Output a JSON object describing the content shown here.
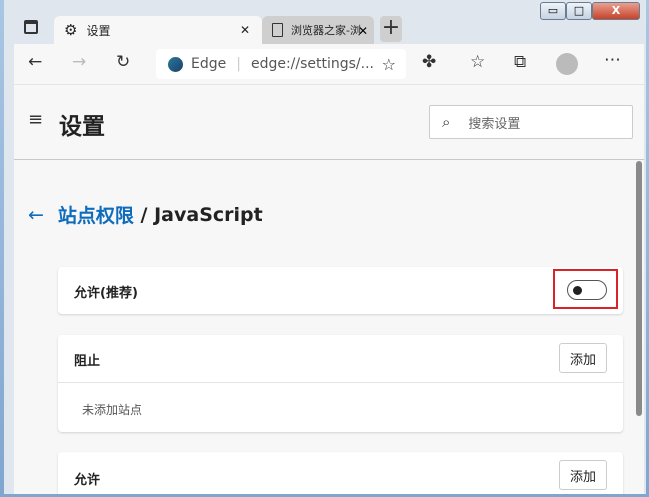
{
  "tabs": [
    {
      "label": "设置",
      "icon": "gear-icon"
    },
    {
      "label": "浏览器之家-浏览器下载_浏",
      "icon": "page-icon"
    }
  ],
  "window_controls": {
    "minimize": "▭",
    "maximize": "□",
    "close": "X"
  },
  "address": {
    "site": "Edge",
    "url": "edge://settings/..."
  },
  "header": {
    "title": "设置",
    "search_placeholder": "搜索设置"
  },
  "breadcrumb": {
    "parent": "站点权限",
    "sep": " / ",
    "current": "JavaScript"
  },
  "allow_recommended": {
    "label": "允许(推荐)",
    "enabled": false
  },
  "block": {
    "title": "阻止",
    "add": "添加",
    "empty": "未添加站点"
  },
  "allow": {
    "title": "允许",
    "add": "添加"
  },
  "colors": {
    "accent": "#0f6cbd",
    "highlight": "#d9222a"
  }
}
